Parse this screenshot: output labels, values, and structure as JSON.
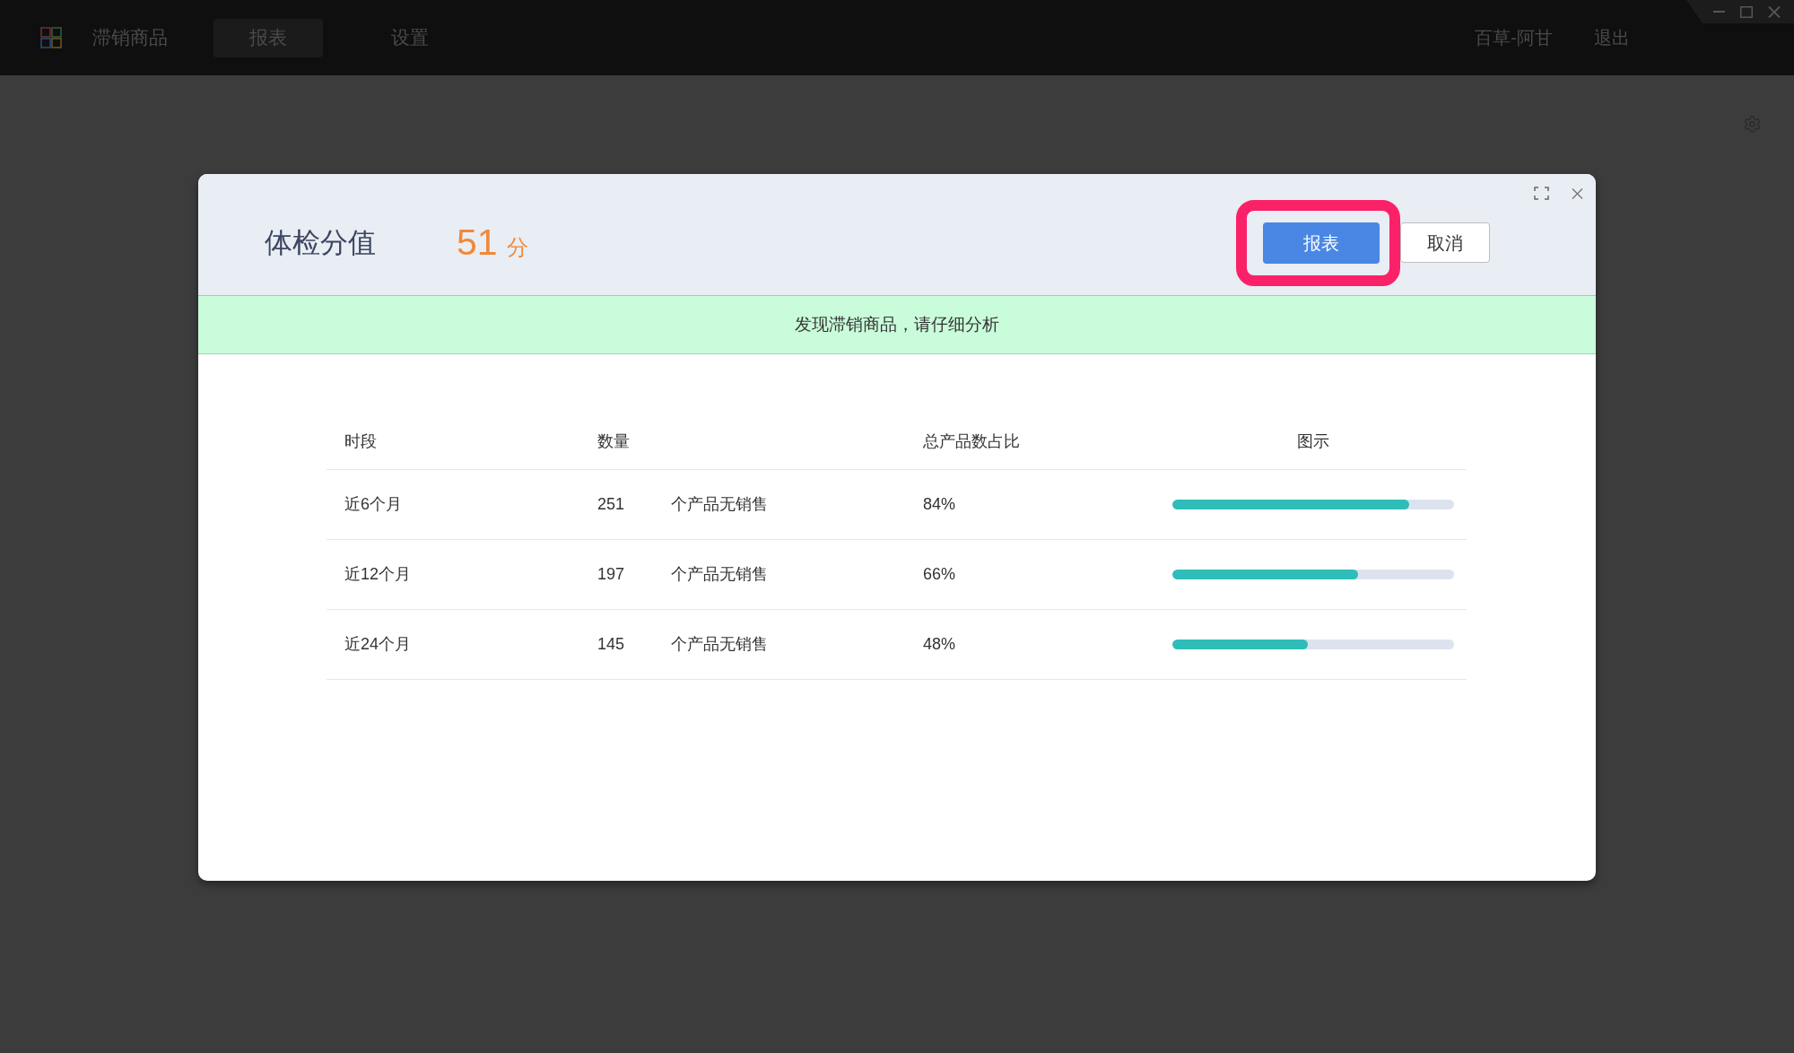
{
  "app_bar": {
    "title": "滞销商品",
    "tabs": [
      {
        "label": "报表",
        "selected": true
      },
      {
        "label": "设置",
        "selected": false
      }
    ],
    "user": "百草-阿甘",
    "logout": "退出"
  },
  "dialog": {
    "title": "体检分值",
    "score": "51",
    "score_unit": "分",
    "buttons": [
      {
        "label": "报表",
        "kind": "primary",
        "highlighted": true
      },
      {
        "label": "取消",
        "kind": "secondary",
        "highlighted": false
      }
    ],
    "notice": "发现滞销商品，请仔细分析",
    "table": {
      "columns": [
        "时段",
        "数量",
        "总产品数占比",
        "图示"
      ],
      "rows": [
        {
          "period": "近6个月",
          "count": "251",
          "count_note": "个产品无销售",
          "share": "84%",
          "level": 0.84
        },
        {
          "period": "近12个月",
          "count": "197",
          "count_note": "个产品无销售",
          "share": "66%",
          "level": 0.66
        },
        {
          "period": "近24个月",
          "count": "145",
          "count_note": "个产品无销售",
          "share": "48%",
          "level": 0.48
        }
      ]
    }
  }
}
